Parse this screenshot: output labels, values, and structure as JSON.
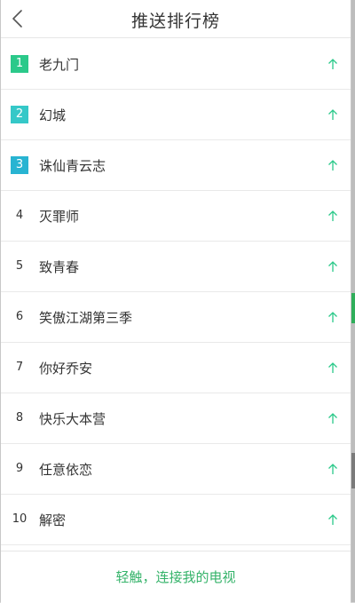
{
  "header": {
    "title": "推送排行榜",
    "back_icon": "chevron-left-icon"
  },
  "ranking": {
    "rank_colors": [
      "#2bc98a",
      "#35c8c8",
      "#28b4d2"
    ],
    "trend_color": "#2bc98a",
    "items": [
      {
        "rank": "1",
        "name": "老九门",
        "trend": "up"
      },
      {
        "rank": "2",
        "name": "幻城",
        "trend": "up"
      },
      {
        "rank": "3",
        "name": "诛仙青云志",
        "trend": "up"
      },
      {
        "rank": "4",
        "name": "灭罪师",
        "trend": "up"
      },
      {
        "rank": "5",
        "name": "致青春",
        "trend": "up"
      },
      {
        "rank": "6",
        "name": "笑傲江湖第三季",
        "trend": "up"
      },
      {
        "rank": "7",
        "name": "你好乔安",
        "trend": "up"
      },
      {
        "rank": "8",
        "name": "快乐大本营",
        "trend": "up"
      },
      {
        "rank": "9",
        "name": "任意依恋",
        "trend": "up"
      },
      {
        "rank": "10",
        "name": "解密",
        "trend": "up"
      }
    ]
  },
  "footer": {
    "action_label": "轻触，连接我的电视",
    "accent_color": "#35b36a"
  }
}
